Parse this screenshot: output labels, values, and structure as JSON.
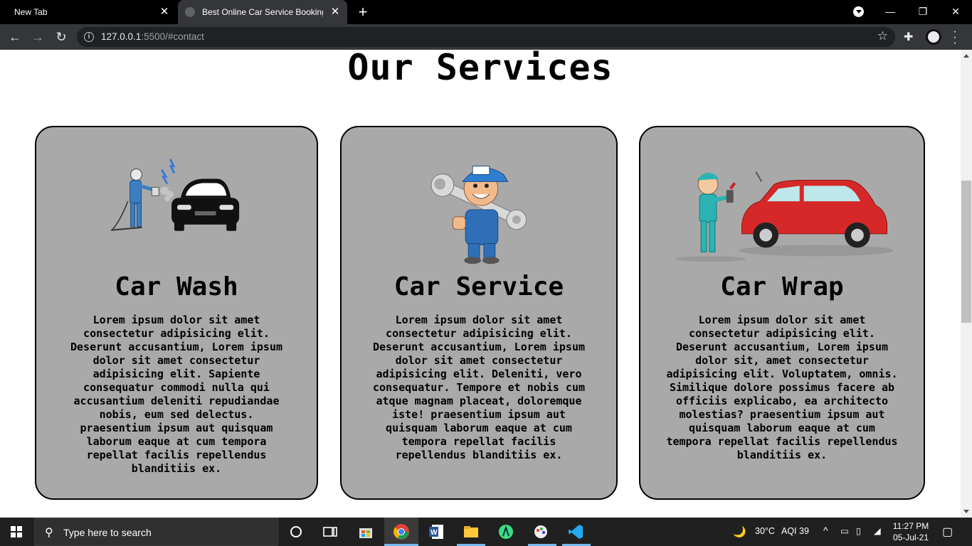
{
  "browser": {
    "tabs": [
      {
        "title": "New Tab"
      },
      {
        "title": "Best Online Car Service Booking"
      }
    ],
    "url": {
      "host": "127.0.0.1",
      "rest": ":5500/#contact"
    }
  },
  "page": {
    "heading": "Our Services",
    "cards": [
      {
        "title": "Car Wash",
        "description": "Lorem ipsum dolor sit amet consectetur adipisicing elit. Deserunt accusantium, Lorem ipsum dolor sit amet consectetur adipisicing elit. Sapiente consequatur commodi nulla qui accusantium deleniti repudiandae nobis, eum sed delectus. praesentium ipsum aut quisquam laborum eaque at cum tempora repellat facilis repellendus blanditiis ex."
      },
      {
        "title": "Car Service",
        "description": "Lorem ipsum dolor sit amet consectetur adipisicing elit. Deserunt accusantium, Lorem ipsum dolor sit amet consectetur adipisicing elit. Deleniti, vero consequatur. Tempore et nobis cum atque magnam placeat, doloremque iste! praesentium ipsum aut quisquam laborum eaque at cum tempora repellat facilis repellendus blanditiis ex."
      },
      {
        "title": "Car Wrap",
        "description": "Lorem ipsum dolor sit amet consectetur adipisicing elit. Deserunt accusantium, Lorem ipsum dolor sit, amet consectetur adipisicing elit. Voluptatem, omnis. Similique dolore possimus facere ab officiis explicabo, ea architecto molestias? praesentium ipsum aut quisquam laborum eaque at cum tempora repellat facilis repellendus blanditiis ex."
      }
    ]
  },
  "taskbar": {
    "search_placeholder": "Type here to search",
    "weather": "30°C",
    "aqi": "AQI 39",
    "time": "11:27 PM",
    "date": "05-Jul-21"
  }
}
